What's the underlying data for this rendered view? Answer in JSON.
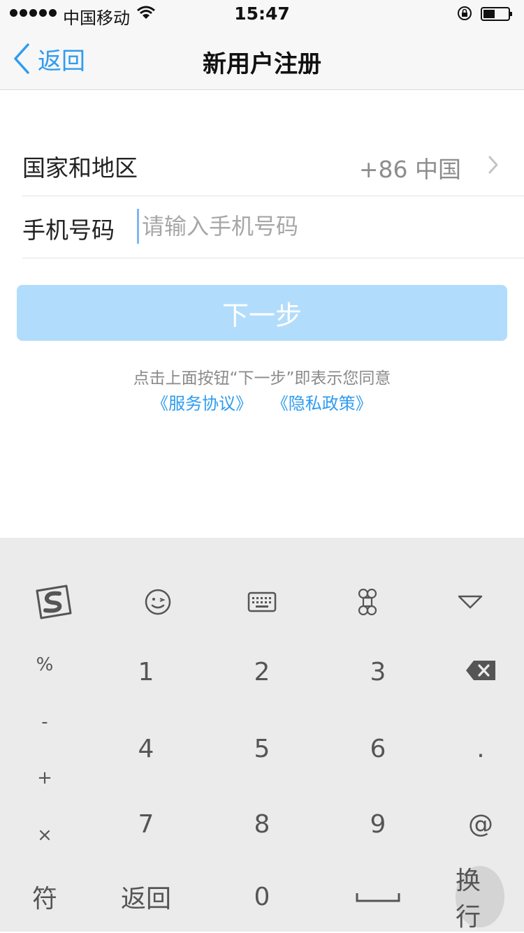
{
  "status_bar": {
    "carrier": "中国移动",
    "time": "15:47"
  },
  "nav": {
    "back_label": "返回",
    "title": "新用户注册"
  },
  "form": {
    "region_label": "国家和地区",
    "region_value": "+86 中国",
    "phone_label": "手机号码",
    "phone_placeholder": "请输入手机号码",
    "phone_value": ""
  },
  "next_button": "下一步",
  "agreement": {
    "notice": "点击上面按钮“下一步”即表示您同意",
    "terms_link": "《服务协议》",
    "privacy_link": "《隐私政策》"
  },
  "keyboard": {
    "toolbar_icons": [
      "sogou-logo-icon",
      "emoji-icon",
      "keyboard-icon",
      "command-icon",
      "collapse-icon"
    ],
    "symbols": [
      "%",
      "-",
      "+",
      "×"
    ],
    "digits": [
      "1",
      "2",
      "3",
      "4",
      "5",
      "6",
      "7",
      "8",
      "9",
      "0"
    ],
    "dot": ".",
    "at": "@",
    "symbol_key": "符",
    "return_key": "返回",
    "enter_key": "换行"
  },
  "colors": {
    "accent": "#2f9cf0",
    "button_disabled": "#b2dcfb",
    "keyboard_bg": "#ebebeb"
  }
}
